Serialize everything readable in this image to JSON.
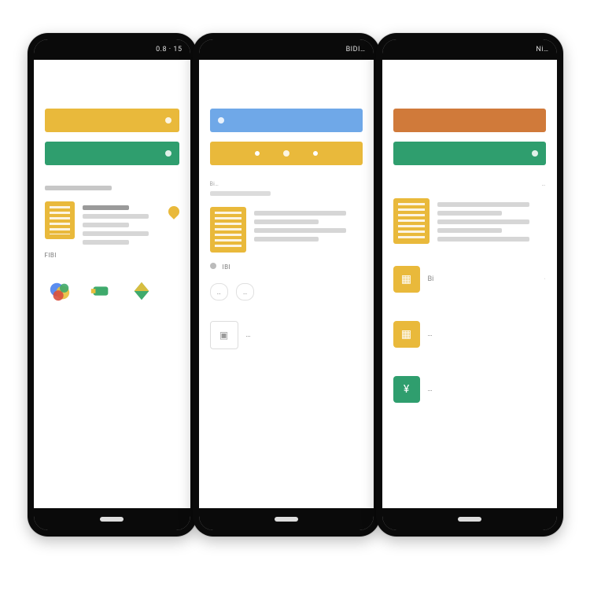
{
  "colors": {
    "yellow": "#e9b93b",
    "green": "#2f9e6e",
    "blue": "#6fa8e8",
    "orange": "#d07a3a"
  },
  "phone1": {
    "status": "0.8 · 15",
    "bars": [
      {
        "color": "yellow",
        "label": ""
      },
      {
        "color": "green",
        "label": ""
      }
    ],
    "doc": {
      "title": "…",
      "caption": "FIBI"
    },
    "iconrow": [
      "a",
      "b",
      "c"
    ]
  },
  "phone2": {
    "status": "BIDI…",
    "bars": [
      {
        "color": "blue",
        "label": ""
      },
      {
        "color": "yellow",
        "label": ""
      }
    ],
    "header": "Bi…",
    "sub": "…",
    "caption": "IBI",
    "chips": [
      "…",
      "…"
    ],
    "list": [
      {
        "t": "…"
      },
      {
        "t": "…"
      }
    ]
  },
  "phone3": {
    "status": "Ni…",
    "bars": [
      {
        "color": "orange",
        "label": ""
      },
      {
        "color": "green",
        "label": ""
      }
    ],
    "header": "…",
    "tiles": [
      {
        "color": "yellow",
        "t": "Bi"
      },
      {
        "color": "yellow",
        "t": "…"
      },
      {
        "color": "green",
        "t": "…"
      }
    ]
  }
}
